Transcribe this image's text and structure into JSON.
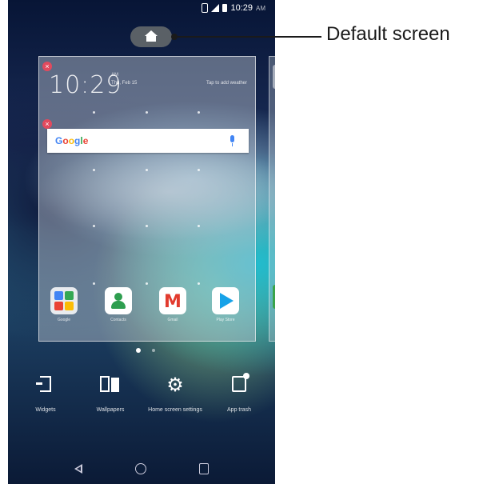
{
  "status_bar": {
    "time": "10:29",
    "ampm": "AM",
    "icons": [
      "vibrate-icon",
      "signal-icon",
      "battery-icon"
    ]
  },
  "home_indicator": {
    "icon": "home-icon"
  },
  "preview": {
    "clock": "10:29",
    "clock_ampm": "AM",
    "clock_date": "Thu, Feb 15",
    "weather_hint": "Tap to add weather",
    "search_widget": {
      "logo": "Google",
      "icon": "mic-icon"
    },
    "apps": [
      {
        "label": "Google",
        "icon": "google-folder-icon"
      },
      {
        "label": "Contacts",
        "icon": "contacts-icon"
      },
      {
        "label": "Gmail",
        "icon": "gmail-icon"
      },
      {
        "label": "Play Store",
        "icon": "play-store-icon"
      }
    ]
  },
  "page_indicator": {
    "current": 1,
    "total": 2
  },
  "edit_options": [
    {
      "label": "Widgets",
      "icon": "widgets-icon"
    },
    {
      "label": "Wallpapers",
      "icon": "wallpapers-icon"
    },
    {
      "label": "Home screen settings",
      "icon": "gear-icon"
    },
    {
      "label": "App trash",
      "icon": "trash-icon"
    }
  ],
  "nav_bar": [
    "back-icon",
    "home-icon",
    "recents-icon"
  ],
  "callout": {
    "text": "Default screen"
  }
}
